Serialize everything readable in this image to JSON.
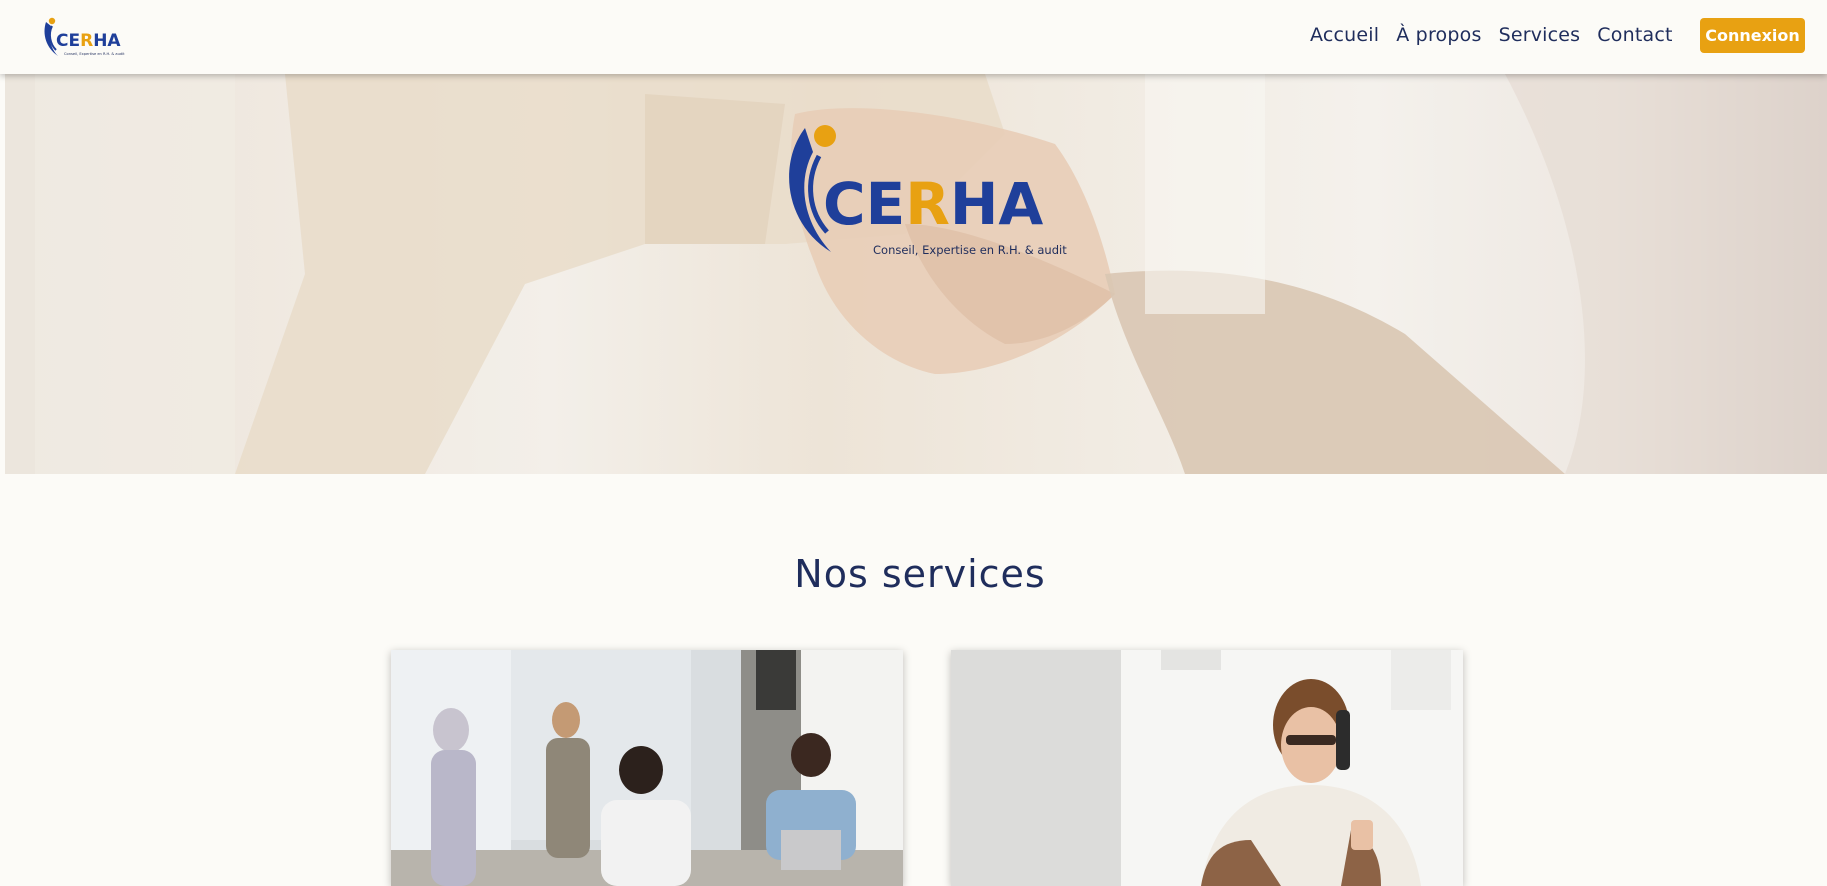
{
  "navbar": {
    "logo_text": "CERHA",
    "logo_tagline": "Conseil, Expertise en R.H. & audit",
    "links": [
      {
        "label": "Accueil"
      },
      {
        "label": "À propos"
      },
      {
        "label": "Services"
      },
      {
        "label": "Contact"
      }
    ],
    "login_label": "Connexion"
  },
  "hero": {
    "logo_text": "CERHA",
    "logo_tagline": "Conseil, Expertise en R.H. & audit"
  },
  "services": {
    "title": "Nos services"
  },
  "colors": {
    "brand_blue": "#1f3f9a",
    "brand_orange": "#e8a112",
    "text_navy": "#1f2d5c",
    "background": "#fcfbf7"
  }
}
